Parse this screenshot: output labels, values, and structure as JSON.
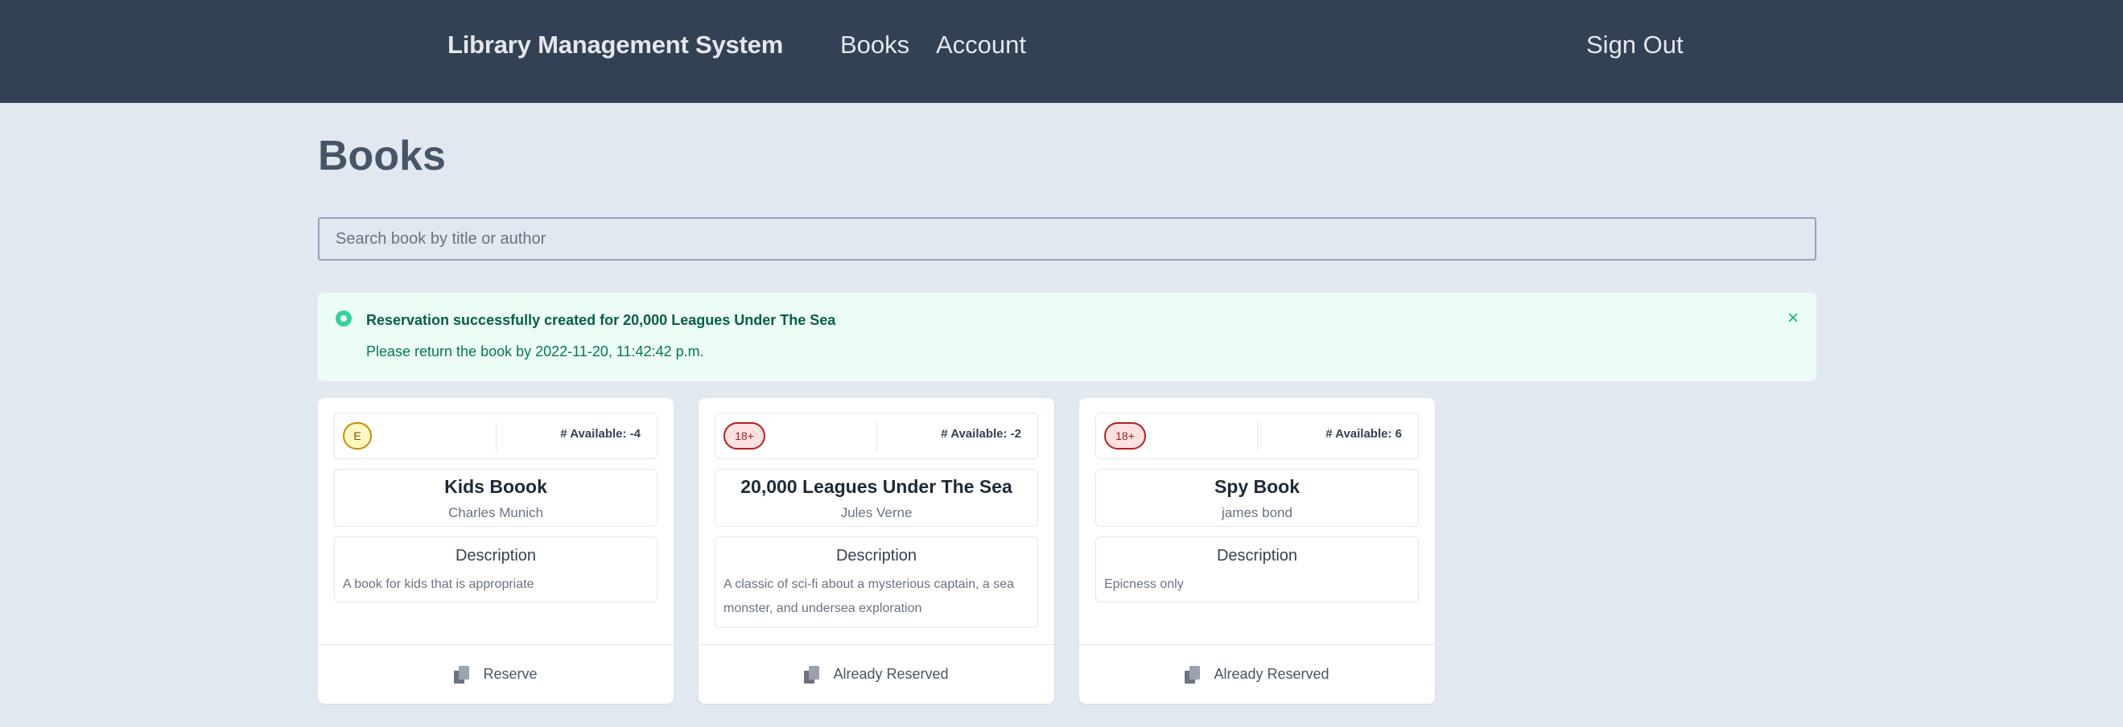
{
  "navbar": {
    "brand": "Library Management System",
    "links": [
      "Books",
      "Account"
    ],
    "sign_out": "Sign Out"
  },
  "page": {
    "title": "Books"
  },
  "search": {
    "placeholder": "Search book by title or author",
    "value": ""
  },
  "alert": {
    "title": "Reservation successfully created for 20,000 Leagues Under The Sea",
    "message": "Please return the book by 2022-11-20, 11:42:42 p.m.",
    "close": "×",
    "icon": "check-circle-icon"
  },
  "books": [
    {
      "rating": "E",
      "available": "# Available: -4",
      "title": "Kids Boook",
      "author": "Charles Munich",
      "description_heading": "Description",
      "description": "A book for kids that is appropriate",
      "action": "Reserve"
    },
    {
      "rating": "18+",
      "available": "# Available: -2",
      "title": "20,000 Leagues Under The Sea",
      "author": "Jules Verne",
      "description_heading": "Description",
      "description": "A classic of sci-fi about a mysterious captain, a sea monster, and undersea exploration",
      "action": "Already Reserved"
    },
    {
      "rating": "18+",
      "available": "# Available: 6",
      "title": "Spy Book",
      "author": "james bond",
      "description_heading": "Description",
      "description": "Epicness only",
      "action": "Already Reserved"
    }
  ],
  "colors": {
    "navbar_bg": "#334155",
    "page_bg": "#e2e8f0",
    "alert_bg": "#ecfdf5",
    "alert_accent": "#10b981",
    "badge_e": "#fef9c3",
    "badge_18": "#fee2e2"
  }
}
